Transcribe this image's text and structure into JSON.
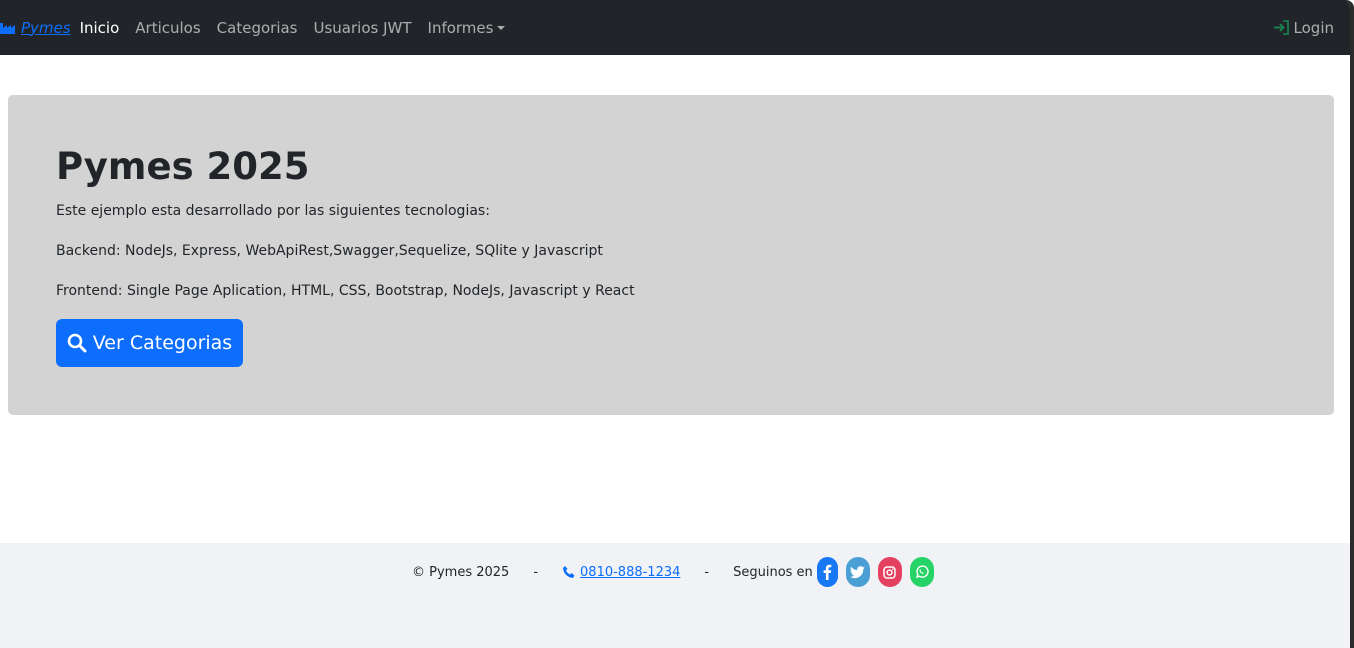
{
  "navbar": {
    "brand": "Pymes",
    "items": [
      {
        "label": "Inicio",
        "active": true
      },
      {
        "label": "Articulos"
      },
      {
        "label": "Categorias"
      },
      {
        "label": "Usuarios JWT"
      },
      {
        "label": "Informes",
        "dropdown": true
      }
    ],
    "login": "Login"
  },
  "jumbotron": {
    "title": "Pymes 2025",
    "lines": [
      "Este ejemplo esta desarrollado por las siguientes tecnologias:",
      "Backend: NodeJs, Express, WebApiRest,Swagger,Sequelize, SQlite y Javascript",
      "Frontend: Single Page Aplication, HTML, CSS, Bootstrap, NodeJs, Javascript y React"
    ],
    "button": "Ver Categorias"
  },
  "footer": {
    "copyright": "© Pymes 2025",
    "separator": "-",
    "phone": "0810-888-1234",
    "follow": "Seguinos en",
    "social": [
      "facebook-icon",
      "twitter-icon",
      "instagram-icon",
      "whatsapp-icon"
    ]
  },
  "colors": {
    "navbar": "#212529",
    "primary": "#0d6efd",
    "jumbotron": "#d3d3d3",
    "footer": "#f0f2f5",
    "login_icon": "#198754"
  }
}
